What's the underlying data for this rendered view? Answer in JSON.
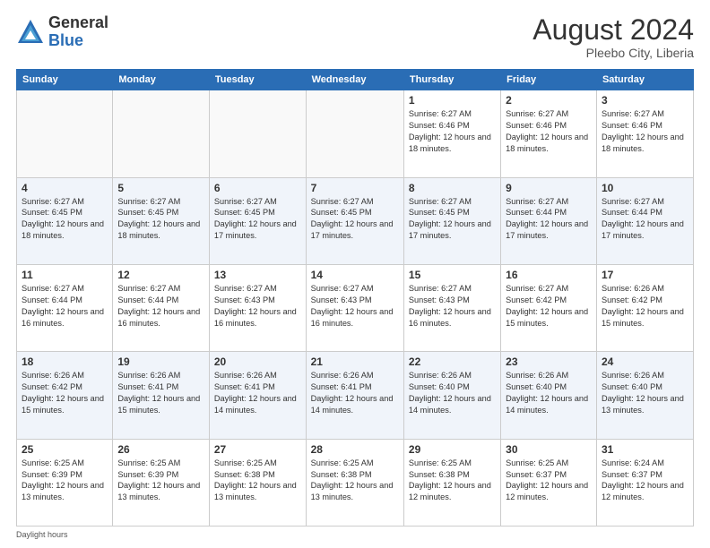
{
  "logo": {
    "general": "General",
    "blue": "Blue"
  },
  "title": "August 2024",
  "subtitle": "Pleebo City, Liberia",
  "days_of_week": [
    "Sunday",
    "Monday",
    "Tuesday",
    "Wednesday",
    "Thursday",
    "Friday",
    "Saturday"
  ],
  "footer": "Daylight hours",
  "weeks": [
    [
      {
        "num": "",
        "info": ""
      },
      {
        "num": "",
        "info": ""
      },
      {
        "num": "",
        "info": ""
      },
      {
        "num": "",
        "info": ""
      },
      {
        "num": "1",
        "info": "Sunrise: 6:27 AM\nSunset: 6:46 PM\nDaylight: 12 hours\nand 18 minutes."
      },
      {
        "num": "2",
        "info": "Sunrise: 6:27 AM\nSunset: 6:46 PM\nDaylight: 12 hours\nand 18 minutes."
      },
      {
        "num": "3",
        "info": "Sunrise: 6:27 AM\nSunset: 6:46 PM\nDaylight: 12 hours\nand 18 minutes."
      }
    ],
    [
      {
        "num": "4",
        "info": "Sunrise: 6:27 AM\nSunset: 6:45 PM\nDaylight: 12 hours\nand 18 minutes."
      },
      {
        "num": "5",
        "info": "Sunrise: 6:27 AM\nSunset: 6:45 PM\nDaylight: 12 hours\nand 18 minutes."
      },
      {
        "num": "6",
        "info": "Sunrise: 6:27 AM\nSunset: 6:45 PM\nDaylight: 12 hours\nand 17 minutes."
      },
      {
        "num": "7",
        "info": "Sunrise: 6:27 AM\nSunset: 6:45 PM\nDaylight: 12 hours\nand 17 minutes."
      },
      {
        "num": "8",
        "info": "Sunrise: 6:27 AM\nSunset: 6:45 PM\nDaylight: 12 hours\nand 17 minutes."
      },
      {
        "num": "9",
        "info": "Sunrise: 6:27 AM\nSunset: 6:44 PM\nDaylight: 12 hours\nand 17 minutes."
      },
      {
        "num": "10",
        "info": "Sunrise: 6:27 AM\nSunset: 6:44 PM\nDaylight: 12 hours\nand 17 minutes."
      }
    ],
    [
      {
        "num": "11",
        "info": "Sunrise: 6:27 AM\nSunset: 6:44 PM\nDaylight: 12 hours\nand 16 minutes."
      },
      {
        "num": "12",
        "info": "Sunrise: 6:27 AM\nSunset: 6:44 PM\nDaylight: 12 hours\nand 16 minutes."
      },
      {
        "num": "13",
        "info": "Sunrise: 6:27 AM\nSunset: 6:43 PM\nDaylight: 12 hours\nand 16 minutes."
      },
      {
        "num": "14",
        "info": "Sunrise: 6:27 AM\nSunset: 6:43 PM\nDaylight: 12 hours\nand 16 minutes."
      },
      {
        "num": "15",
        "info": "Sunrise: 6:27 AM\nSunset: 6:43 PM\nDaylight: 12 hours\nand 16 minutes."
      },
      {
        "num": "16",
        "info": "Sunrise: 6:27 AM\nSunset: 6:42 PM\nDaylight: 12 hours\nand 15 minutes."
      },
      {
        "num": "17",
        "info": "Sunrise: 6:26 AM\nSunset: 6:42 PM\nDaylight: 12 hours\nand 15 minutes."
      }
    ],
    [
      {
        "num": "18",
        "info": "Sunrise: 6:26 AM\nSunset: 6:42 PM\nDaylight: 12 hours\nand 15 minutes."
      },
      {
        "num": "19",
        "info": "Sunrise: 6:26 AM\nSunset: 6:41 PM\nDaylight: 12 hours\nand 15 minutes."
      },
      {
        "num": "20",
        "info": "Sunrise: 6:26 AM\nSunset: 6:41 PM\nDaylight: 12 hours\nand 14 minutes."
      },
      {
        "num": "21",
        "info": "Sunrise: 6:26 AM\nSunset: 6:41 PM\nDaylight: 12 hours\nand 14 minutes."
      },
      {
        "num": "22",
        "info": "Sunrise: 6:26 AM\nSunset: 6:40 PM\nDaylight: 12 hours\nand 14 minutes."
      },
      {
        "num": "23",
        "info": "Sunrise: 6:26 AM\nSunset: 6:40 PM\nDaylight: 12 hours\nand 14 minutes."
      },
      {
        "num": "24",
        "info": "Sunrise: 6:26 AM\nSunset: 6:40 PM\nDaylight: 12 hours\nand 13 minutes."
      }
    ],
    [
      {
        "num": "25",
        "info": "Sunrise: 6:25 AM\nSunset: 6:39 PM\nDaylight: 12 hours\nand 13 minutes."
      },
      {
        "num": "26",
        "info": "Sunrise: 6:25 AM\nSunset: 6:39 PM\nDaylight: 12 hours\nand 13 minutes."
      },
      {
        "num": "27",
        "info": "Sunrise: 6:25 AM\nSunset: 6:38 PM\nDaylight: 12 hours\nand 13 minutes."
      },
      {
        "num": "28",
        "info": "Sunrise: 6:25 AM\nSunset: 6:38 PM\nDaylight: 12 hours\nand 13 minutes."
      },
      {
        "num": "29",
        "info": "Sunrise: 6:25 AM\nSunset: 6:38 PM\nDaylight: 12 hours\nand 12 minutes."
      },
      {
        "num": "30",
        "info": "Sunrise: 6:25 AM\nSunset: 6:37 PM\nDaylight: 12 hours\nand 12 minutes."
      },
      {
        "num": "31",
        "info": "Sunrise: 6:24 AM\nSunset: 6:37 PM\nDaylight: 12 hours\nand 12 minutes."
      }
    ]
  ]
}
